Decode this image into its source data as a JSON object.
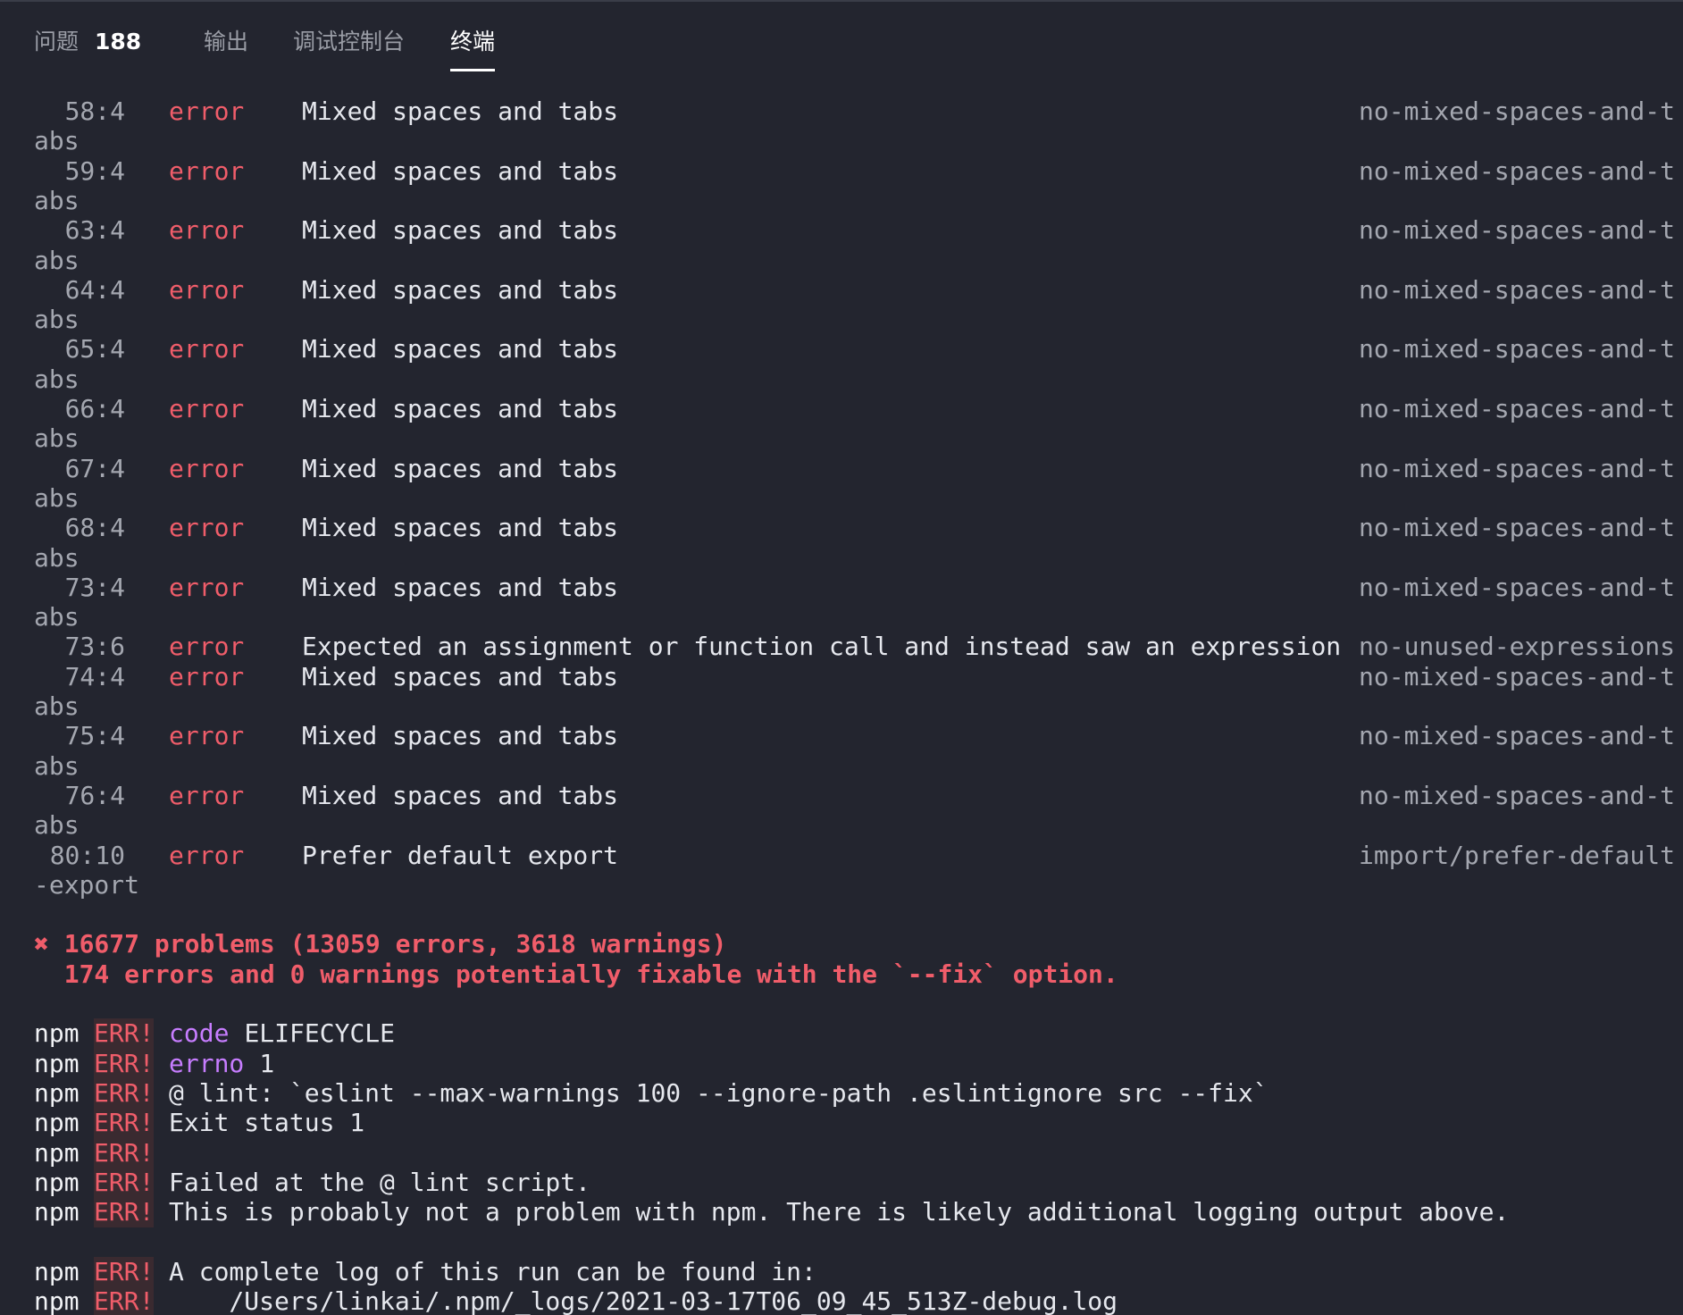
{
  "tabs": {
    "problems_label": "问题",
    "problems_count": "188",
    "output_label": "输出",
    "debug_label": "调试控制台",
    "terminal_label": "终端"
  },
  "lint_rows": [
    {
      "pos": "58:4",
      "level": "error",
      "message": "Mixed spaces and tabs",
      "rule": "no-mixed-spaces-and-t",
      "wrap": "abs"
    },
    {
      "pos": "59:4",
      "level": "error",
      "message": "Mixed spaces and tabs",
      "rule": "no-mixed-spaces-and-t",
      "wrap": "abs"
    },
    {
      "pos": "63:4",
      "level": "error",
      "message": "Mixed spaces and tabs",
      "rule": "no-mixed-spaces-and-t",
      "wrap": "abs"
    },
    {
      "pos": "64:4",
      "level": "error",
      "message": "Mixed spaces and tabs",
      "rule": "no-mixed-spaces-and-t",
      "wrap": "abs"
    },
    {
      "pos": "65:4",
      "level": "error",
      "message": "Mixed spaces and tabs",
      "rule": "no-mixed-spaces-and-t",
      "wrap": "abs"
    },
    {
      "pos": "66:4",
      "level": "error",
      "message": "Mixed spaces and tabs",
      "rule": "no-mixed-spaces-and-t",
      "wrap": "abs"
    },
    {
      "pos": "67:4",
      "level": "error",
      "message": "Mixed spaces and tabs",
      "rule": "no-mixed-spaces-and-t",
      "wrap": "abs"
    },
    {
      "pos": "68:4",
      "level": "error",
      "message": "Mixed spaces and tabs",
      "rule": "no-mixed-spaces-and-t",
      "wrap": "abs"
    },
    {
      "pos": "73:4",
      "level": "error",
      "message": "Mixed spaces and tabs",
      "rule": "no-mixed-spaces-and-t",
      "wrap": "abs"
    },
    {
      "pos": "73:6",
      "level": "error",
      "message": "Expected an assignment or function call and instead saw an expression",
      "rule": "no-unused-expressions",
      "wrap": ""
    },
    {
      "pos": "74:4",
      "level": "error",
      "message": "Mixed spaces and tabs",
      "rule": "no-mixed-spaces-and-t",
      "wrap": "abs"
    },
    {
      "pos": "75:4",
      "level": "error",
      "message": "Mixed spaces and tabs",
      "rule": "no-mixed-spaces-and-t",
      "wrap": "abs"
    },
    {
      "pos": "76:4",
      "level": "error",
      "message": "Mixed spaces and tabs",
      "rule": "no-mixed-spaces-and-t",
      "wrap": "abs"
    },
    {
      "pos": "80:10",
      "level": "error",
      "message": "Prefer default export",
      "rule": "import/prefer-default",
      "wrap": "-export"
    }
  ],
  "summary": {
    "line1": "✖ 16677 problems (13059 errors, 3618 warnings)",
    "line2": "  174 errors and 0 warnings potentially fixable with the `--fix` option."
  },
  "npm_lines": [
    {
      "prefix": "npm",
      "label": "ERR!",
      "key": "code",
      "text": " ELIFECYCLE"
    },
    {
      "prefix": "npm",
      "label": "ERR!",
      "key": "errno",
      "text": " 1"
    },
    {
      "prefix": "npm",
      "label": "ERR!",
      "key": "",
      "text": "@ lint: `eslint --max-warnings 100 --ignore-path .eslintignore src --fix`"
    },
    {
      "prefix": "npm",
      "label": "ERR!",
      "key": "",
      "text": "Exit status 1"
    },
    {
      "prefix": "npm",
      "label": "ERR!",
      "key": "",
      "text": ""
    },
    {
      "prefix": "npm",
      "label": "ERR!",
      "key": "",
      "text": "Failed at the @ lint script."
    },
    {
      "prefix": "npm",
      "label": "ERR!",
      "key": "",
      "text": "This is probably not a problem with npm. There is likely additional logging output above."
    },
    {
      "prefix": "npm",
      "label": "ERR!",
      "key": "",
      "text": "A complete log of this run can be found in:"
    },
    {
      "prefix": "npm",
      "label": "ERR!",
      "key": "",
      "text": "    /Users/linkai/.npm/_logs/2021-03-17T06_09_45_513Z-debug.log"
    }
  ],
  "colors": {
    "background": "#23252f",
    "error": "#f05d6a",
    "keyword": "#c77dff",
    "muted": "#a4a7b0",
    "text": "#e6e8ee"
  }
}
